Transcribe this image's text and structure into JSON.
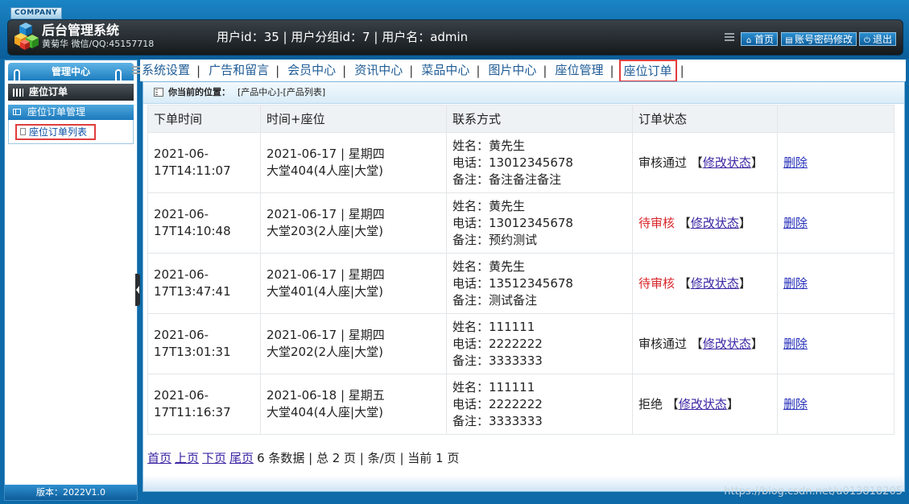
{
  "header": {
    "company": "COMPANY",
    "title": "后台管理系统",
    "subtitle": "黄菊华 微信/QQ:45157718",
    "user_info": "用户id：35 | 用户分组id：7 | 用户名：admin",
    "buttons": {
      "home": "首页",
      "password": "账号密码修改",
      "logout": "退出"
    }
  },
  "sidebar": {
    "tab": "管理中心",
    "section": "座位订单",
    "group": "座位订单管理",
    "item": "座位订单列表",
    "version": "版本：2022V1.0"
  },
  "nav": {
    "items": [
      "系统设置",
      "广告和留言",
      "会员中心",
      "资讯中心",
      "菜品中心",
      "图片中心",
      "座位管理",
      "座位订单"
    ],
    "active_index": 7
  },
  "breadcrumb": {
    "label": "你当前的位置：",
    "path": "[产品中心]-[产品列表]"
  },
  "table": {
    "headers": [
      "下单时间",
      "时间+座位",
      "联系方式",
      "订单状态",
      ""
    ],
    "rows": [
      {
        "time_a": "2021-06-",
        "time_b": "17T14:11:07",
        "seat_a": "2021-06-17 | 星期四",
        "seat_b": "大堂404(4人座|大堂)",
        "name": "姓名：黄先生",
        "phone": "电话：13012345678",
        "note": "备注：备注备注备注",
        "status": "审核通过",
        "modify": "修改状态",
        "delete": "删除"
      },
      {
        "time_a": "2021-06-",
        "time_b": "17T14:10:48",
        "seat_a": "2021-06-17 | 星期四",
        "seat_b": "大堂203(2人座|大堂)",
        "name": "姓名：黄先生",
        "phone": "电话：13012345678",
        "note": "备注：预约测试",
        "status": "待审核",
        "modify": "修改状态",
        "delete": "删除"
      },
      {
        "time_a": "2021-06-",
        "time_b": "17T13:47:41",
        "seat_a": "2021-06-17 | 星期四",
        "seat_b": "大堂401(4人座|大堂)",
        "name": "姓名：黄先生",
        "phone": "电话：13512345678",
        "note": "备注：测试备注",
        "status": "待审核",
        "modify": "修改状态",
        "delete": "删除"
      },
      {
        "time_a": "2021-06-",
        "time_b": "17T13:01:31",
        "seat_a": "2021-06-17 | 星期四",
        "seat_b": "大堂202(2人座|大堂)",
        "name": "姓名：111111",
        "phone": "电话：2222222",
        "note": "备注：3333333",
        "status": "审核通过",
        "modify": "修改状态",
        "delete": "删除"
      },
      {
        "time_a": "2021-06-",
        "time_b": "17T11:16:37",
        "seat_a": "2021-06-18 | 星期五",
        "seat_b": "大堂404(4人座|大堂)",
        "name": "姓名：111111",
        "phone": "电话：2222222",
        "note": "备注：3333333",
        "status": "拒绝",
        "modify": "修改状态",
        "delete": "删除"
      }
    ]
  },
  "pager": {
    "first": "首页",
    "prev": "上页",
    "next": "下页",
    "last": "尾页",
    "summary": "6 条数据 | 总 2 页 | 条/页 | 当前 1 页"
  },
  "watermark": "https://blog.csdn.net/u013818205",
  "colors": {
    "header": "#0a5d99",
    "active_border": "#e13d3d",
    "pending": "#d8252a",
    "link": "#3b24a3"
  }
}
